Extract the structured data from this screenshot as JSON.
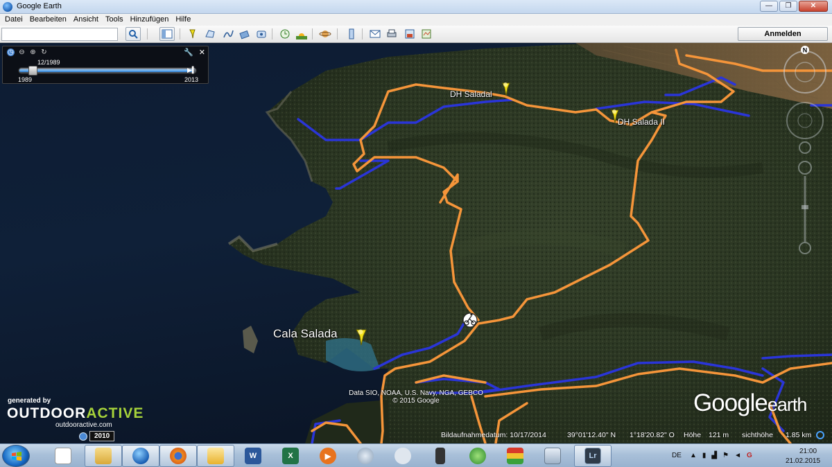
{
  "window": {
    "title": "Google Earth",
    "minimize": "—",
    "maximize": "❐",
    "close": "✕"
  },
  "menu": [
    "Datei",
    "Bearbeiten",
    "Ansicht",
    "Tools",
    "Hinzufügen",
    "Hilfe"
  ],
  "toolbar": {
    "search_value": "",
    "login_label": "Anmelden",
    "icons": [
      "search-icon",
      "sidebar-icon",
      "placemark-icon",
      "polygon-icon",
      "path-icon",
      "image-overlay-icon",
      "tour-icon",
      "historical-imagery-icon",
      "sunlight-icon",
      "planets-icon",
      "ruler-icon",
      "email-icon",
      "print-icon",
      "save-image-icon",
      "maps-icon"
    ]
  },
  "time_slider": {
    "current": "12/1989",
    "start": "1989",
    "end": "2013",
    "position_fraction": 0.0
  },
  "places": {
    "dh_saladal": "DH Saladal",
    "dh_salada_ii": "DH Salada II",
    "cala_salada": "Cala Salada"
  },
  "credits": {
    "data": "Data SIO, NOAA, U.S. Navy, NGA, GEBCO",
    "copyright": "© 2015 Google"
  },
  "branding": {
    "generated_by": "generated by",
    "brand_part1": "OUTDOOR",
    "brand_part2": "ACTIVE",
    "url": "outdooractive.com",
    "year": "2010",
    "google": "Google",
    "earth": "earth"
  },
  "status": {
    "imagery_date": "Bildaufnahmedatum: 10/17/2014",
    "latitude": "39°01'12.40\" N",
    "longitude": "1°18'20.82\" O",
    "elevation_label": "Höhe",
    "elevation": "121 m",
    "eye_label": "sichthöhe",
    "eye": "1.85 km"
  },
  "compass": {
    "north": "N"
  },
  "taskbar": {
    "apps": [
      "explorer-file",
      "library",
      "google-earth",
      "firefox",
      "outlook",
      "word",
      "excel",
      "media-player",
      "arc",
      "cloud",
      "phone",
      "security",
      "traffic",
      "calculator",
      "lightroom"
    ],
    "active": "google-earth",
    "lightroom_label": "Lr",
    "word_label": "W",
    "excel_label": "X",
    "tray_lang": "DE",
    "time": "21:00",
    "date": "21.02.2015"
  },
  "colors": {
    "route_orange": "#f5953a",
    "route_blue": "#2a35d8",
    "pin_yellow": "#f2e21a"
  }
}
